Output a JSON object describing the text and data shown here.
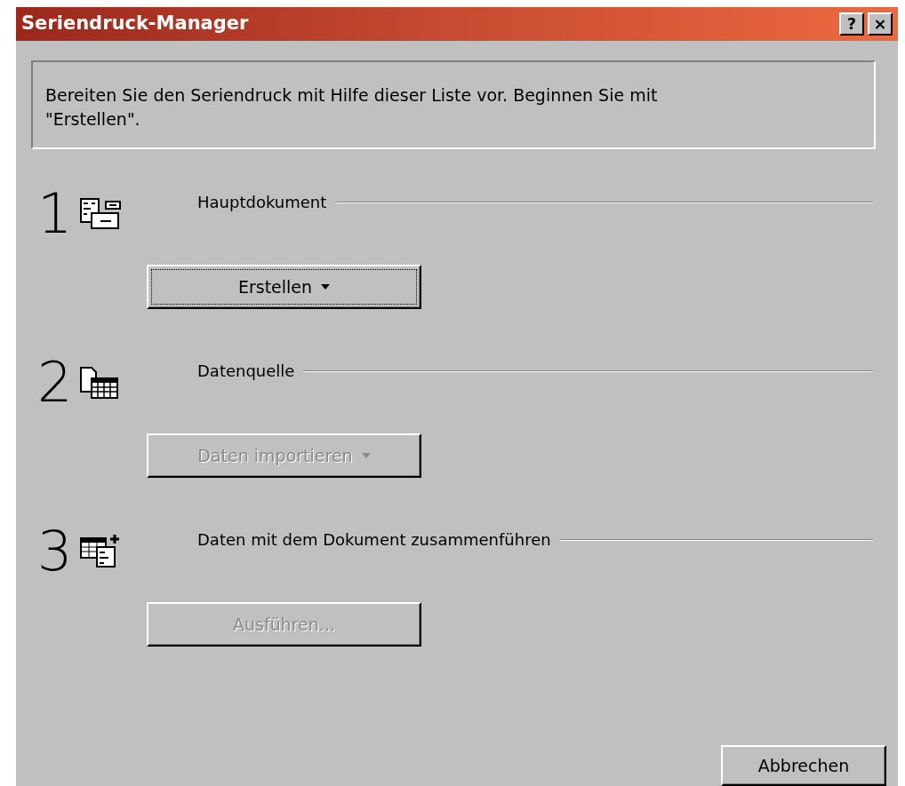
{
  "window": {
    "title": "Seriendruck-Manager",
    "buttons": [
      "?",
      "×"
    ]
  },
  "intro": "Bereiten Sie den Seriendruck mit Hilfe dieser Liste vor. Beginnen Sie mit \"Erstellen\".",
  "steps": [
    {
      "number": "1",
      "label": "Hauptdokument",
      "button": {
        "label": "Erstellen",
        "dropdown": true,
        "disabled": false,
        "focused": true
      }
    },
    {
      "number": "2",
      "label": "Datenquelle",
      "button": {
        "label": "Daten importieren",
        "dropdown": true,
        "disabled": true,
        "focused": false
      }
    },
    {
      "number": "3",
      "label": "Daten mit dem Dokument zusammenführen",
      "button": {
        "label": "Ausführen...",
        "dropdown": false,
        "disabled": true,
        "focused": false
      }
    }
  ],
  "footer_buttons": [
    {
      "label": "Abbrechen",
      "disabled": false
    }
  ]
}
